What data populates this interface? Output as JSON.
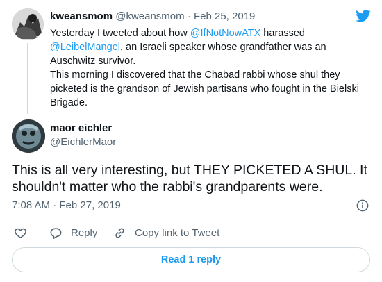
{
  "parent": {
    "name": "kweansmom",
    "handle": "@kweansmom",
    "separator": "·",
    "date": "Feb 25, 2019",
    "text_parts": {
      "p1": "Yesterday I tweeted about how ",
      "m1": "@IfNotNowATX",
      "p2": " harassed ",
      "m2": "@LeibelMangel",
      "p3": ", an Israeli speaker whose grandfather was an Auschwitz survivor.",
      "p4": "This morning I discovered that the Chabad rabbi whose shul they picketed is the grandson of Jewish partisans who fought in the Bielski Brigade."
    }
  },
  "tweet": {
    "name": "maor eichler",
    "handle": "@EichlerMaor",
    "text": "This is all very interesting, but THEY PICKETED A SHUL. It shouldn't matter who the rabbi's grandparents were.",
    "time": "7:08 AM",
    "separator": "·",
    "date": "Feb 27, 2019"
  },
  "actions": {
    "reply_label": "Reply",
    "copy_label": "Copy link to Tweet"
  },
  "read_reply_label": "Read 1 reply",
  "icons": {
    "brand": "twitter-bird-icon",
    "like": "heart-icon",
    "reply": "reply-bubble-icon",
    "copy": "link-icon",
    "info": "info-icon"
  },
  "colors": {
    "accent": "#1d9bf0",
    "text": "#0f1419",
    "muted": "#536471",
    "border": "#cfd9de"
  }
}
